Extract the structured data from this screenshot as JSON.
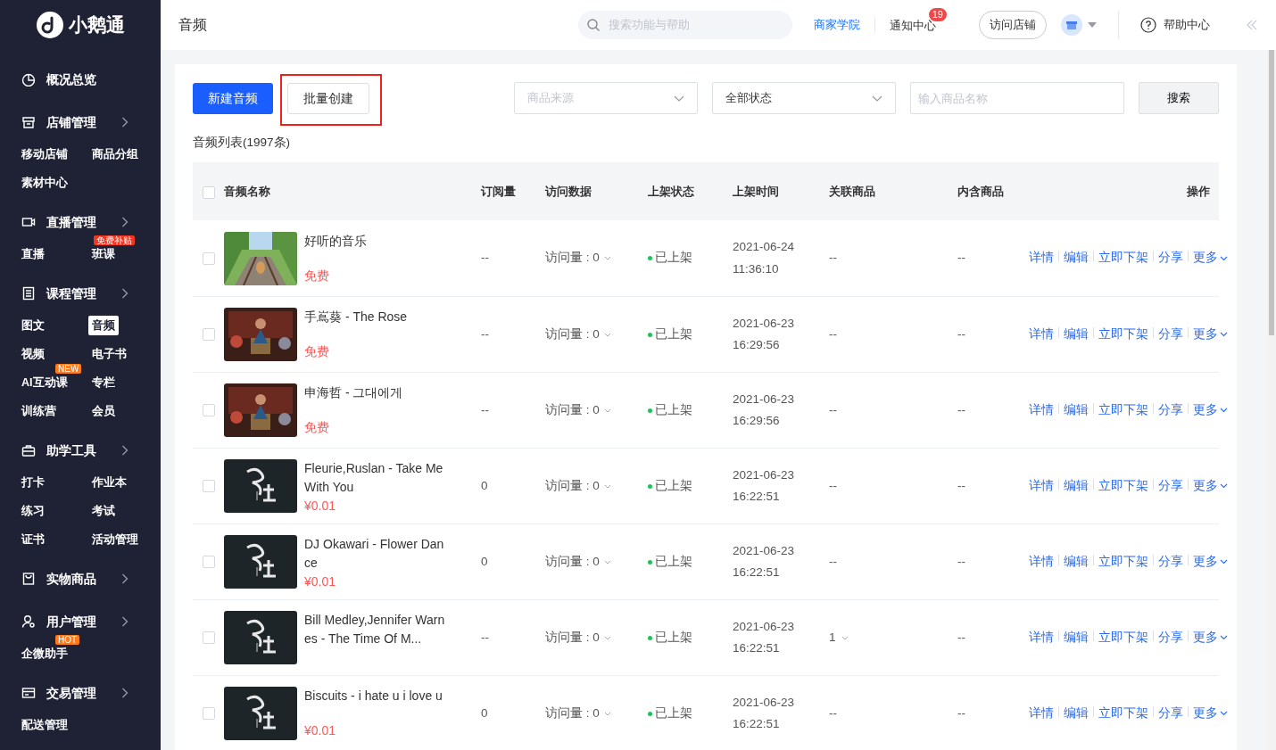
{
  "sidebar": {
    "logo": "小鹅通",
    "groups": [
      {
        "label": "概况总览",
        "expandable": false
      },
      {
        "label": "店铺管理",
        "expandable": true,
        "items": [
          {
            "label": "移动店铺",
            "selected": false
          },
          {
            "label": "商品分组",
            "selected": false
          },
          {
            "label": "素材中心",
            "selected": false
          }
        ]
      },
      {
        "label": "直播管理",
        "expandable": true,
        "items": [
          {
            "label": "直播",
            "selected": false
          },
          {
            "label": "班课",
            "selected": false,
            "badge": "免费补贴",
            "color": "#f5331f"
          }
        ]
      },
      {
        "label": "课程管理",
        "expandable": true,
        "items": [
          {
            "label": "图文",
            "selected": false
          },
          {
            "label": "音频",
            "selected": true
          },
          {
            "label": "视频",
            "selected": false
          },
          {
            "label": "电子书",
            "selected": false
          },
          {
            "label": "AI互动课",
            "selected": false,
            "badge": "NEW",
            "color": "#ff7a1a"
          },
          {
            "label": "专栏",
            "selected": false
          },
          {
            "label": "训练营",
            "selected": false
          },
          {
            "label": "会员",
            "selected": false
          }
        ]
      },
      {
        "label": "助学工具",
        "expandable": true,
        "items": [
          {
            "label": "打卡",
            "selected": false
          },
          {
            "label": "作业本",
            "selected": false
          },
          {
            "label": "练习",
            "selected": false
          },
          {
            "label": "考试",
            "selected": false
          },
          {
            "label": "证书",
            "selected": false
          },
          {
            "label": "活动管理",
            "selected": false
          }
        ]
      },
      {
        "label": "实物商品",
        "expandable": true
      },
      {
        "label": "用户管理",
        "expandable": true,
        "items": [
          {
            "label": "企微助手",
            "selected": false,
            "badge": "HOT",
            "color": "#ff7a1a"
          }
        ]
      },
      {
        "label": "交易管理",
        "expandable": true,
        "items": [
          {
            "label": "配送管理",
            "selected": false
          }
        ]
      }
    ]
  },
  "topbar": {
    "title": "音频",
    "search": {
      "placeholder": "搜索功能与帮助"
    },
    "academy_link": "商家学院",
    "notifications": {
      "label": "通知中心",
      "count": "19"
    },
    "visit_store": "访问店铺",
    "help": "帮助中心"
  },
  "toolbar": {
    "buttons": [
      {
        "label": "新建音频",
        "kind": "primary",
        "highlighted": false
      },
      {
        "label": "批量创建",
        "kind": "default",
        "highlighted": true
      }
    ],
    "filters": [
      {
        "kind": "select",
        "placeholder": "商品来源"
      },
      {
        "kind": "select",
        "value": "全部状态"
      },
      {
        "kind": "input",
        "placeholder": "输入商品名称"
      }
    ],
    "search_button": "搜索"
  },
  "list_count": "音频列表(1997条)",
  "table": {
    "select_all": {
      "checked": false
    },
    "columns": [
      "音频名称",
      "订阅量",
      "访问数据",
      "上架状态",
      "上架时间",
      "关联商品",
      "内含商品",
      "操作"
    ],
    "rows": [
      {
        "checked": false,
        "title": "好听的音乐",
        "price": "免费",
        "subscriptions": "--",
        "visits": "访问量 : 0",
        "status": "已上架",
        "date": "2021-06-24",
        "time": "11:36:10",
        "related": "--",
        "related_expandable": false,
        "contained": "--",
        "actions": [
          "详情",
          "编辑",
          "立即下架",
          "分享",
          "更多"
        ]
      },
      {
        "checked": false,
        "title": "手嶌葵 - The Rose",
        "price": "免费",
        "subscriptions": "--",
        "visits": "访问量 : 0",
        "status": "已上架",
        "date": "2021-06-23",
        "time": "16:29:56",
        "related": "--",
        "related_expandable": false,
        "contained": "--",
        "actions": [
          "详情",
          "编辑",
          "立即下架",
          "分享",
          "更多"
        ]
      },
      {
        "checked": false,
        "title": "申海哲 - 그대에게",
        "price": "免费",
        "subscriptions": "--",
        "visits": "访问量 : 0",
        "status": "已上架",
        "date": "2021-06-23",
        "time": "16:29:56",
        "related": "--",
        "related_expandable": false,
        "contained": "--",
        "actions": [
          "详情",
          "编辑",
          "立即下架",
          "分享",
          "更多"
        ]
      },
      {
        "checked": false,
        "title": "Fleurie,Ruslan - Take Me With You",
        "price": "¥0.01",
        "subscriptions": "0",
        "visits": "访问量 : 0",
        "status": "已上架",
        "date": "2021-06-23",
        "time": "16:22:51",
        "related": "--",
        "related_expandable": false,
        "contained": "--",
        "actions": [
          "详情",
          "编辑",
          "立即下架",
          "分享",
          "更多"
        ]
      },
      {
        "checked": false,
        "title": "DJ Okawari - Flower Dance",
        "price": "¥0.01",
        "subscriptions": "0",
        "visits": "访问量 : 0",
        "status": "已上架",
        "date": "2021-06-23",
        "time": "16:22:51",
        "related": "--",
        "related_expandable": false,
        "contained": "--",
        "actions": [
          "详情",
          "编辑",
          "立即下架",
          "分享",
          "更多"
        ]
      },
      {
        "checked": false,
        "title": "Bill Medley,Jennifer Warnes - The Time Of M...",
        "subscriptions": "--",
        "visits": "访问量 : 0",
        "status": "已上架",
        "date": "2021-06-23",
        "time": "16:22:51",
        "related": "1",
        "related_expandable": true,
        "contained": "--",
        "actions": [
          "详情",
          "编辑",
          "立即下架",
          "分享",
          "更多"
        ]
      },
      {
        "checked": false,
        "title": "Biscuits - i hate u i love u",
        "price": "¥0.01",
        "subscriptions": "0",
        "visits": "访问量 : 0",
        "status": "已上架",
        "date": "2021-06-23",
        "time": "16:22:51",
        "related": "--",
        "related_expandable": false,
        "contained": "--",
        "actions": [
          "详情",
          "编辑",
          "立即下架",
          "分享",
          "更多"
        ]
      }
    ]
  }
}
